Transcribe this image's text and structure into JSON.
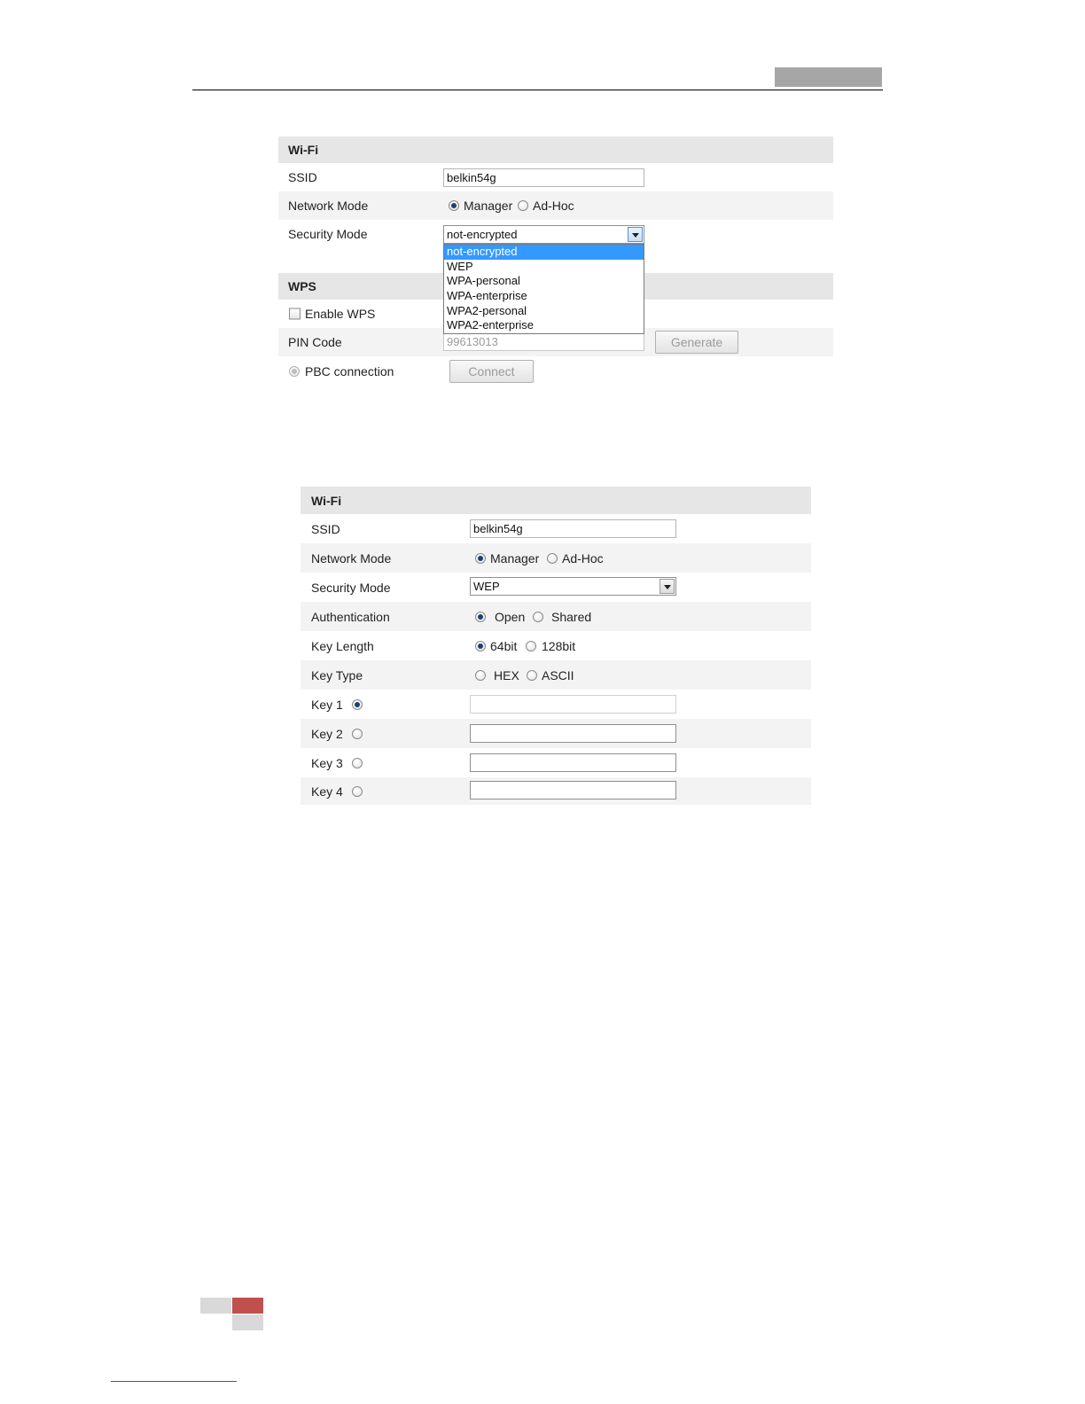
{
  "panel1": {
    "wifi_title": "Wi-Fi",
    "ssid_label": "SSID",
    "ssid_value": "belkin54g",
    "network_mode_label": "Network Mode",
    "manager_label": "Manager",
    "adhoc_label": "Ad-Hoc",
    "security_mode_label": "Security Mode",
    "security_mode_value": "not-encrypted",
    "security_options": [
      "not-encrypted",
      "WEP",
      "WPA-personal",
      "WPA-enterprise",
      "WPA2-personal",
      "WPA2-enterprise"
    ],
    "wps_title": "WPS",
    "enable_wps_label": "Enable WPS",
    "pin_code_label": "PIN Code",
    "pin_code_value": "99613013",
    "generate_label": "Generate",
    "pbc_label": "PBC connection",
    "connect_label": "Connect"
  },
  "panel2": {
    "wifi_title": "Wi-Fi",
    "ssid_label": "SSID",
    "ssid_value": "belkin54g",
    "network_mode_label": "Network Mode",
    "manager_label": "Manager",
    "adhoc_label": "Ad-Hoc",
    "security_mode_label": "Security Mode",
    "security_mode_value": "WEP",
    "authentication_label": "Authentication",
    "open_label": "Open",
    "shared_label": "Shared",
    "key_length_label": "Key Length",
    "bit64_label": "64bit",
    "bit128_label": "128bit",
    "key_type_label": "Key Type",
    "hex_label": "HEX",
    "ascii_label": "ASCII",
    "key1_label": "Key 1",
    "key2_label": "Key 2",
    "key3_label": "Key 3",
    "key4_label": "Key 4"
  },
  "colors": {
    "section_bg": "#e6e6e6",
    "row_shade": "#f3f3f3",
    "selected_option": "#3399ff",
    "footer_red": "#c0504d"
  }
}
